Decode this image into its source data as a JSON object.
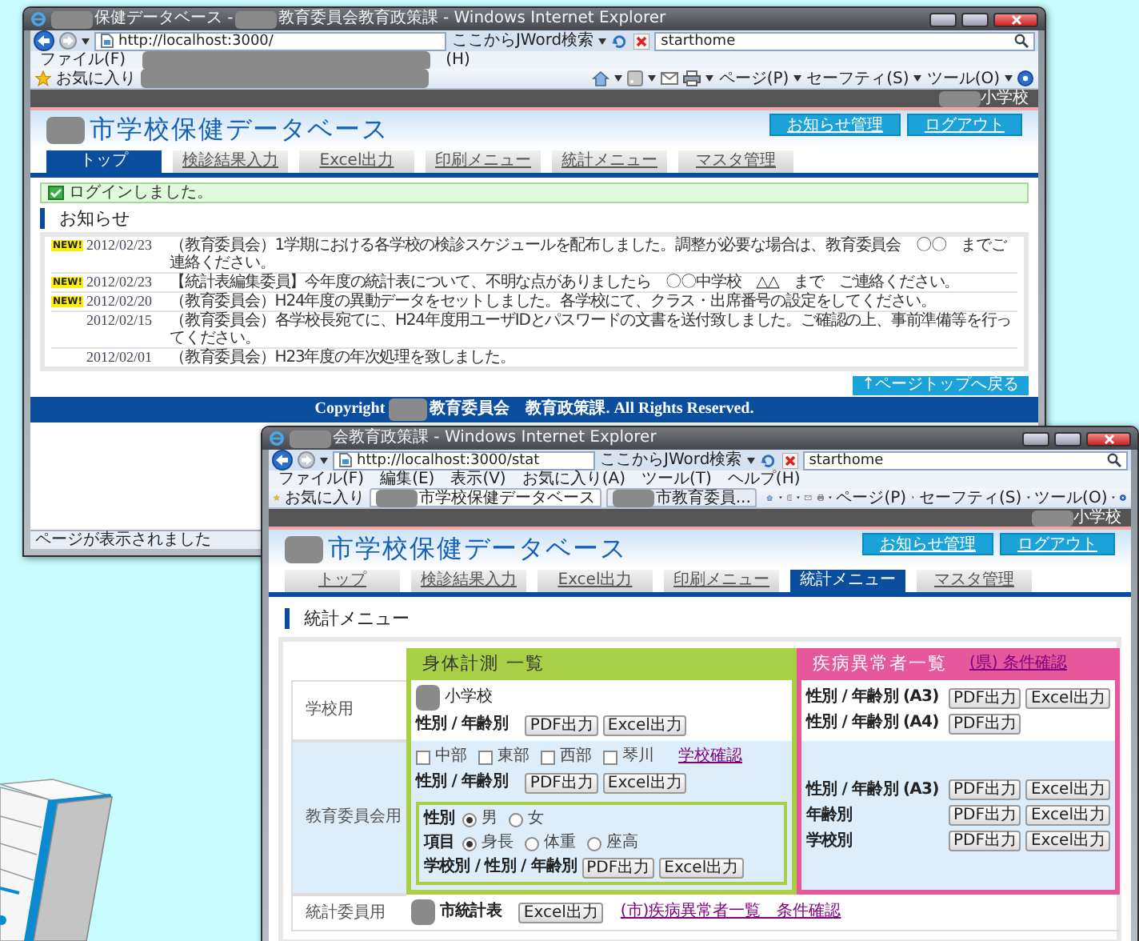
{
  "windows": [
    {
      "title_parts": [
        {
          "kind": "redacted"
        },
        {
          "kind": "text",
          "text": "保健データベース - "
        },
        {
          "kind": "redacted"
        },
        {
          "kind": "text",
          "text": "教育委員会教育政策課 - Windows Internet Explorer"
        }
      ],
      "address": "http://localhost:3000/",
      "search_provider": "ここからJWord検索",
      "search_text": "starthome",
      "menu": [
        {
          "kind": "text",
          "text": "ファイル(F)"
        },
        {
          "kind": "redacted"
        },
        {
          "kind": "text",
          "text": "(H)"
        }
      ],
      "favorites": {
        "label": "お気に入り",
        "tabs": [
          {
            "kind": "redacted"
          }
        ]
      },
      "command_bar": [
        "ページ(P)",
        "セーフティ(S)",
        "ツール(O)"
      ],
      "school": {
        "redacted_prefix": true,
        "text": "小学校"
      },
      "site_title": {
        "redacted_prefix": true,
        "text": "市学校保健データベース"
      },
      "header_buttons": [
        "お知らせ管理",
        "ログアウト"
      ],
      "nav_tabs": [
        {
          "label": "トップ",
          "selected": true
        },
        {
          "label": "検診結果入力",
          "selected": false
        },
        {
          "label": "Excel出力",
          "selected": false
        },
        {
          "label": "印刷メニュー",
          "selected": false
        },
        {
          "label": "統計メニュー",
          "selected": false
        },
        {
          "label": "マスタ管理",
          "selected": false
        }
      ],
      "page": {
        "kind": "notices",
        "message": "ログインしました。",
        "heading": "お知らせ",
        "notices": [
          {
            "badge": "NEW!",
            "date": "2012/02/23",
            "text": "（教育委員会）1学期における各学校の検診スケジュールを配布しました。調整が必要な場合は、教育委員会　〇〇　までご連絡ください。"
          },
          {
            "badge": "NEW!",
            "date": "2012/02/23",
            "text": "【統計表編集委員】今年度の統計表について、不明な点がありましたら　〇〇中学校　△△　まで　ご連絡ください。"
          },
          {
            "badge": "NEW!",
            "date": "2012/02/20",
            "text": "（教育委員会）H24年度の異動データをセットしました。各学校にて、クラス・出席番号の設定をしてください。"
          },
          {
            "date": "2012/02/15",
            "text": "（教育委員会）各学校長宛てに、H24年度用ユーザIDとパスワードの文書を送付致しました。ご確認の上、事前準備等を行ってください。"
          },
          {
            "date": "2012/02/01",
            "text": "（教育委員会）H23年度の年次処理を致しました。"
          }
        ],
        "page_top": "↑ページトップへ戻る",
        "footer": {
          "prefix": "Copyright",
          "redacted_gap": true,
          "text": "教育委員会　教育政策課. All Rights Reserved."
        }
      },
      "status_bar": "ページが表示されました"
    },
    {
      "title_parts": [
        {
          "kind": "redacted"
        },
        {
          "kind": "text",
          "text": "会教育政策課 - Windows Internet Explorer"
        }
      ],
      "address": "http://localhost:3000/stat",
      "search_provider": "ここからJWord検索",
      "search_text": "starthome",
      "menu": [
        {
          "kind": "text",
          "text": "ファイル(F)"
        },
        {
          "kind": "text",
          "text": "編集(E)"
        },
        {
          "kind": "text",
          "text": "表示(V)"
        },
        {
          "kind": "text",
          "text": "お気に入り(A)"
        },
        {
          "kind": "text",
          "text": "ツール(T)"
        },
        {
          "kind": "text",
          "text": "ヘルプ(H)"
        }
      ],
      "favorites": {
        "label": "お気に入り",
        "tabs": [
          {
            "kind": "tab",
            "redacted_prefix": true,
            "text": "市学校保健データベース",
            "selected": true
          },
          {
            "kind": "tab",
            "redacted_prefix": true,
            "text": "市教育委員...",
            "selected": false
          }
        ]
      },
      "command_bar": [
        "ページ(P)",
        "セーフティ(S)",
        "ツール(O)"
      ],
      "school": {
        "redacted_prefix": true,
        "text": "小学校"
      },
      "site_title": {
        "redacted_prefix": true,
        "text": "市学校保健データベース"
      },
      "header_buttons": [
        "お知らせ管理",
        "ログアウト"
      ],
      "nav_tabs": [
        {
          "label": "トップ",
          "selected": false
        },
        {
          "label": "検診結果入力",
          "selected": false
        },
        {
          "label": "Excel出力",
          "selected": false
        },
        {
          "label": "印刷メニュー",
          "selected": false
        },
        {
          "label": "統計メニュー",
          "selected": true
        },
        {
          "label": "マスタ管理",
          "selected": false
        }
      ],
      "page": {
        "kind": "stats",
        "heading": "統計メニュー",
        "columns": [
          {
            "title": "身体計測 一覧",
            "color": "#a8cf45"
          },
          {
            "title": "疾病異常者一覧",
            "color": "#e6579b",
            "link": "(県) 条件確認"
          }
        ],
        "rows": [
          {
            "label": "学校用",
            "shaded": false,
            "cells": [
              {
                "items": [
                  {
                    "kind": "school",
                    "redacted_prefix": true,
                    "text": "小学校"
                  },
                  {
                    "kind": "line",
                    "label": "性別 / 年齢別",
                    "buttons": [
                      "PDF出力",
                      "Excel出力"
                    ]
                  }
                ]
              },
              {
                "items": [
                  {
                    "kind": "line",
                    "label": "性別 / 年齢別 (A3)",
                    "buttons": [
                      "PDF出力",
                      "Excel出力"
                    ]
                  },
                  {
                    "kind": "line",
                    "label": "性別 / 年齢別 (A4)",
                    "buttons": [
                      "PDF出力"
                    ]
                  }
                ]
              }
            ]
          },
          {
            "label": "教育委員会用",
            "shaded": true,
            "cells": [
              {
                "items": [
                  {
                    "kind": "checkboxes",
                    "options": [
                      {
                        "label": "中部",
                        "checked": false
                      },
                      {
                        "label": "東部",
                        "checked": false
                      },
                      {
                        "label": "西部",
                        "checked": false
                      },
                      {
                        "label": "琴川",
                        "checked": false
                      }
                    ],
                    "link": "学校確認"
                  },
                  {
                    "kind": "line",
                    "label": "性別 / 年齢別",
                    "buttons": [
                      "PDF出力",
                      "Excel出力"
                    ]
                  },
                  {
                    "kind": "group",
                    "items": [
                      {
                        "kind": "radios",
                        "label": "性別",
                        "options": [
                          {
                            "label": "男",
                            "selected": true
                          },
                          {
                            "label": "女",
                            "selected": false
                          }
                        ]
                      },
                      {
                        "kind": "radios",
                        "label": "項目",
                        "options": [
                          {
                            "label": "身長",
                            "selected": true
                          },
                          {
                            "label": "体重",
                            "selected": false
                          },
                          {
                            "label": "座高",
                            "selected": false
                          }
                        ]
                      },
                      {
                        "kind": "line",
                        "label": "学校別 / 性別 / 年齢別",
                        "buttons": [
                          "PDF出力",
                          "Excel出力"
                        ]
                      }
                    ]
                  }
                ]
              },
              {
                "items": [
                  {
                    "kind": "line",
                    "label": "性別 / 年齢別 (A3)",
                    "buttons": [
                      "PDF出力",
                      "Excel出力"
                    ]
                  },
                  {
                    "kind": "line",
                    "label": "年齢別",
                    "buttons": [
                      "PDF出力",
                      "Excel出力"
                    ]
                  },
                  {
                    "kind": "line",
                    "label": "学校別",
                    "buttons": [
                      "PDF出力",
                      "Excel出力"
                    ]
                  }
                ]
              }
            ]
          },
          {
            "label": "統計委員用",
            "shaded": false,
            "cells": [
              {
                "items": [
                  {
                    "kind": "line",
                    "redacted_prefix": true,
                    "label": "市統計表",
                    "buttons": [
                      "Excel出力"
                    ],
                    "link": "(市)疾病異常者一覧　条件確認"
                  }
                ]
              }
            ]
          }
        ]
      }
    }
  ]
}
